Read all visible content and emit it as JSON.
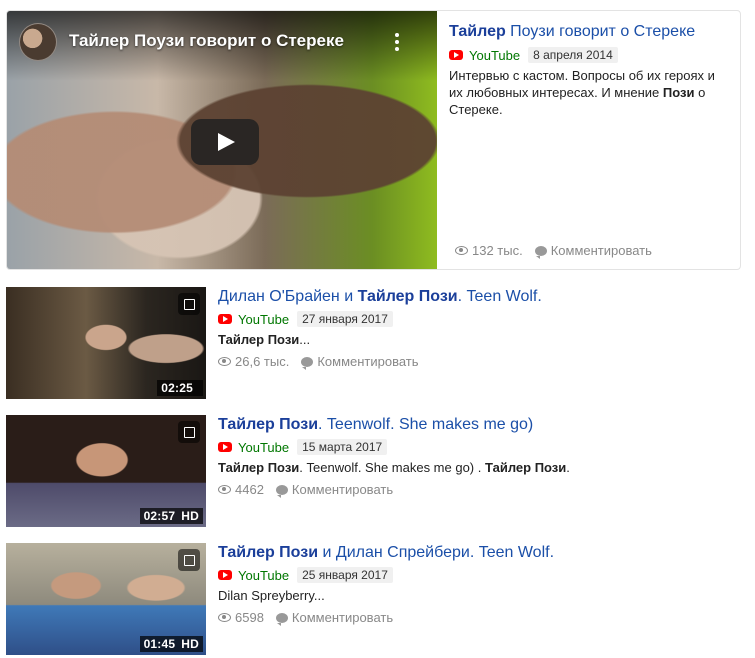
{
  "featured": {
    "video_overlay_title": "Тайлер Поузи говорит о Стереке",
    "title_bold": "Тайлер",
    "title_rest": " Поузи говорит о Стереке",
    "source": "YouTube",
    "date": "8 апреля 2014",
    "desc_before": "Интервью с кастом. Вопросы об их героях и их любовных интересах. И мнение ",
    "desc_bold": "Пози",
    "desc_after": " о Стереке.",
    "views": "132 тыс.",
    "comment_label": "Комментировать"
  },
  "results": [
    {
      "title_parts": [
        {
          "text": "Дилан О'Брайен и ",
          "bold": false
        },
        {
          "text": "Тайлер Пози",
          "bold": true
        },
        {
          "text": ". Teen Wolf.",
          "bold": false
        }
      ],
      "source": "YouTube",
      "date": "27 января 2017",
      "snippet_parts": [
        {
          "text": "Тайлер Пози",
          "bold": true
        },
        {
          "text": "...",
          "bold": false
        }
      ],
      "views": "26,6 тыс.",
      "comment_label": "Комментировать",
      "duration": "02:25",
      "hd": ""
    },
    {
      "title_parts": [
        {
          "text": "Тайлер Пози",
          "bold": true
        },
        {
          "text": ". Teenwolf. She makes me go)",
          "bold": false
        }
      ],
      "source": "YouTube",
      "date": "15 марта 2017",
      "snippet_parts": [
        {
          "text": "Тайлер Пози",
          "bold": true
        },
        {
          "text": ". Teenwolf. She makes me go) . ",
          "bold": false
        },
        {
          "text": "Тайлер Пози",
          "bold": true
        },
        {
          "text": ".",
          "bold": false
        }
      ],
      "views": "4462",
      "comment_label": "Комментировать",
      "duration": "02:57",
      "hd": "HD"
    },
    {
      "title_parts": [
        {
          "text": "Тайлер Пози",
          "bold": true
        },
        {
          "text": " и Дилан Спрейбери. Teen Wolf.",
          "bold": false
        }
      ],
      "source": "YouTube",
      "date": "25 января 2017",
      "snippet_parts": [
        {
          "text": "Dilan Spreyberry...",
          "bold": false
        }
      ],
      "views": "6598",
      "comment_label": "Комментировать",
      "duration": "01:45",
      "hd": "HD"
    }
  ]
}
